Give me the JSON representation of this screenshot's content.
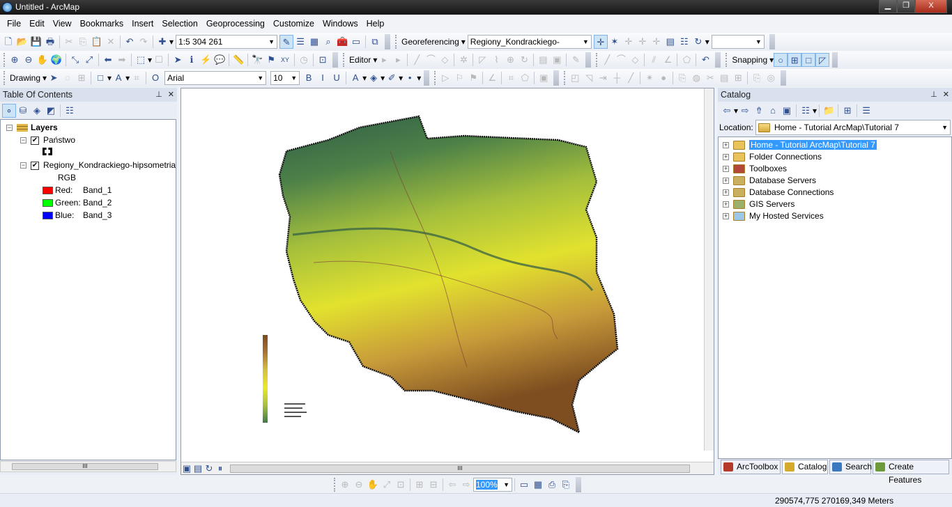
{
  "window": {
    "title": "Untitled - ArcMap",
    "minimize": "▁",
    "restore": "❐",
    "close": "X"
  },
  "menu": [
    "File",
    "Edit",
    "View",
    "Bookmarks",
    "Insert",
    "Selection",
    "Geoprocessing",
    "Customize",
    "Windows",
    "Help"
  ],
  "toolbar1": [
    {
      "i": "new-document",
      "g": "🗋"
    },
    {
      "i": "open",
      "g": "📂"
    },
    {
      "i": "save",
      "g": "💾"
    },
    {
      "i": "print",
      "g": "🖶"
    },
    {
      "s": 1
    },
    {
      "i": "cut",
      "g": "✂",
      "d": 1
    },
    {
      "i": "copy",
      "g": "⎘",
      "d": 1
    },
    {
      "i": "paste",
      "g": "📋"
    },
    {
      "i": "delete",
      "g": "✕",
      "d": 1
    },
    {
      "s": 1
    },
    {
      "i": "undo",
      "g": "↶"
    },
    {
      "i": "redo",
      "g": "↷",
      "d": 1
    },
    {
      "s": 1
    },
    {
      "i": "add-data",
      "g": "✚",
      "dd": 1
    },
    {
      "combo": "1:5 304 261",
      "w": 146,
      "n": "map-scale-combo"
    },
    {
      "i": "editor-toolbar",
      "g": "✎",
      "a": 1
    },
    {
      "i": "table-of-contents-window",
      "g": "☰"
    },
    {
      "i": "catalog-window",
      "g": "▦"
    },
    {
      "i": "search-window",
      "g": "⌕"
    },
    {
      "i": "arctoolbox-window",
      "g": "🧰"
    },
    {
      "i": "python-window",
      "g": "▭"
    },
    {
      "s": 1
    },
    {
      "i": "modelbuilder",
      "g": "⧉"
    },
    {
      "grip": 1
    },
    {
      "dots": 1
    },
    {
      "label": "Georeferencing",
      "dd": 1,
      "n": "georeferencing-menu"
    },
    {
      "combo": "Regiony_Kondrackiego-hipsomet",
      "w": 178,
      "n": "georeference-layer-combo"
    },
    {
      "i": "add-control-points",
      "g": "✛",
      "a": 1
    },
    {
      "i": "auto-adjust",
      "g": "✶"
    },
    {
      "i": "rotate",
      "g": "✛",
      "d": 1
    },
    {
      "i": "shift",
      "g": "✛",
      "d": 1
    },
    {
      "i": "scale",
      "g": "✛",
      "d": 1
    },
    {
      "i": "view-link-table",
      "g": "▤"
    },
    {
      "i": "link-table",
      "g": "☷"
    },
    {
      "i": "flip-rotate",
      "g": "↻",
      "dd": 1
    },
    {
      "combo": "",
      "w": 76,
      "n": "rotation-input"
    },
    {
      "grip": 1
    }
  ],
  "toolbar2": [
    {
      "dots": 1
    },
    {
      "i": "zoom-in",
      "g": "⊕"
    },
    {
      "i": "zoom-out",
      "g": "⊖"
    },
    {
      "i": "pan",
      "g": "✋"
    },
    {
      "i": "full-extent",
      "g": "🌍"
    },
    {
      "s": 1
    },
    {
      "i": "fixed-zoom-in",
      "g": "⤡"
    },
    {
      "i": "fixed-zoom-out",
      "g": "⤢"
    },
    {
      "s": 1
    },
    {
      "i": "back-extent",
      "g": "⬅"
    },
    {
      "i": "forward-extent",
      "g": "➡",
      "d": 1
    },
    {
      "s": 1
    },
    {
      "i": "select-features",
      "g": "⬚",
      "dd": 1
    },
    {
      "i": "clear-selection",
      "g": "☐",
      "d": 1
    },
    {
      "s": 1
    },
    {
      "i": "select-elements",
      "g": "➤"
    },
    {
      "i": "identify",
      "g": "ℹ"
    },
    {
      "i": "hyperlink",
      "g": "⚡",
      "d": 1
    },
    {
      "i": "html-popup",
      "g": "💬"
    },
    {
      "s": 1
    },
    {
      "i": "measure",
      "g": "📏"
    },
    {
      "s": 1
    },
    {
      "i": "find",
      "g": "🔭"
    },
    {
      "i": "find-route",
      "g": "⚑"
    },
    {
      "i": "go-to-xy",
      "g": "XY"
    },
    {
      "s": 1
    },
    {
      "i": "time-slider",
      "g": "◷",
      "d": 1
    },
    {
      "s": 1
    },
    {
      "i": "create-viewer-window",
      "g": "⊡"
    },
    {
      "grip": 1
    },
    {
      "dots": 1
    },
    {
      "label": "Editor",
      "dd": 1,
      "n": "editor-menu"
    },
    {
      "i": "edit-tool",
      "g": "▸",
      "d": 1
    },
    {
      "i": "edit-annotation",
      "g": "▸",
      "d": 1
    },
    {
      "s": 1
    },
    {
      "i": "straight-segment",
      "g": "╱",
      "d": 1
    },
    {
      "i": "endpoint-arc",
      "g": "⌒",
      "d": 1
    },
    {
      "i": "construction",
      "g": "◇",
      "d": 1
    },
    {
      "s": 1
    },
    {
      "i": "cut-polygons",
      "g": "✲",
      "d": 1
    },
    {
      "s": 1
    },
    {
      "i": "edit-vertices",
      "g": "◸",
      "d": 1
    },
    {
      "i": "reshape",
      "g": "⌇",
      "d": 1
    },
    {
      "i": "split",
      "g": "⊕",
      "d": 1
    },
    {
      "i": "rotate-tool",
      "g": "↻",
      "d": 1
    },
    {
      "s": 1
    },
    {
      "i": "attributes",
      "g": "▤",
      "d": 1
    },
    {
      "i": "sketch-properties",
      "g": "▣",
      "d": 1
    },
    {
      "s": 1
    },
    {
      "i": "create-features",
      "g": "✎",
      "d": 1
    },
    {
      "grip": 1
    },
    {
      "dots": 1
    },
    {
      "i": "line",
      "g": "╱",
      "d": 1
    },
    {
      "i": "curve",
      "g": "⌒",
      "d": 1
    },
    {
      "i": "trace",
      "g": "◇",
      "d": 1
    },
    {
      "s": 1
    },
    {
      "i": "parallel",
      "g": "⫽",
      "d": 1
    },
    {
      "i": "angle",
      "g": "∠",
      "d": 1
    },
    {
      "s": 1
    },
    {
      "i": "polygon",
      "g": "⬠",
      "d": 1
    },
    {
      "s": 1
    },
    {
      "i": "undo-edit",
      "g": "↶"
    },
    {
      "grip": 1
    },
    {
      "dots": 1
    },
    {
      "label": "Snapping",
      "dd": 1,
      "n": "snapping-menu"
    },
    {
      "i": "point-snapping",
      "g": "○",
      "a": 1
    },
    {
      "i": "end-snapping",
      "g": "⊞",
      "a": 1
    },
    {
      "i": "vertex-snapping",
      "g": "□",
      "a": 1
    },
    {
      "i": "edge-snapping",
      "g": "◸",
      "a": 1
    },
    {
      "grip": 1
    }
  ],
  "toolbar3": [
    {
      "dots": 1
    },
    {
      "label": "Drawing",
      "dd": 1,
      "n": "drawing-menu"
    },
    {
      "i": "select-elements",
      "g": "➤"
    },
    {
      "i": "rotate-element",
      "g": "◌",
      "d": 1
    },
    {
      "i": "zoom-to-selected",
      "g": "⊞",
      "d": 1
    },
    {
      "s": 1
    },
    {
      "i": "rectangle",
      "g": "□",
      "dd": 1
    },
    {
      "i": "new-text",
      "g": "A",
      "dd": 1
    },
    {
      "i": "edit-vertices",
      "g": "⌗",
      "d": 1
    },
    {
      "s": 1
    },
    {
      "i": "font-type",
      "g": "O"
    },
    {
      "combo": "Arial",
      "w": 146,
      "n": "font-combo"
    },
    {
      "combo": "10",
      "w": 42,
      "n": "font-size-combo"
    },
    {
      "i": "bold",
      "g": "B"
    },
    {
      "i": "italic",
      "g": "I"
    },
    {
      "i": "underline",
      "g": "U"
    },
    {
      "s": 1
    },
    {
      "i": "font-color",
      "g": "A",
      "dd": 1
    },
    {
      "i": "fill-color",
      "g": "◈",
      "dd": 1
    },
    {
      "i": "line-color",
      "g": "✐",
      "dd": 1
    },
    {
      "i": "marker-color",
      "g": "•",
      "dd": 1
    },
    {
      "grip": 1
    },
    {
      "dots": 1
    },
    {
      "i": "edit-annotation-tool",
      "g": "▷",
      "d": 1
    },
    {
      "i": "add-feature",
      "g": "⚐",
      "d": 1
    },
    {
      "i": "follow-feature",
      "g": "⚑",
      "d": 1
    },
    {
      "s": 1
    },
    {
      "i": "leader",
      "g": "∠",
      "d": 1
    },
    {
      "s": 1
    },
    {
      "i": "convert",
      "g": "⌗",
      "d": 1
    },
    {
      "i": "polygon-tool",
      "g": "⬠",
      "d": 1
    },
    {
      "s": 1
    },
    {
      "i": "properties",
      "g": "▣",
      "d": 1
    },
    {
      "grip": 1
    },
    {
      "dots": 1
    },
    {
      "i": "topology-edit",
      "g": "◰",
      "d": 1
    },
    {
      "i": "topology-modify",
      "g": "◹",
      "d": 1
    },
    {
      "i": "split-lines",
      "g": "⇥",
      "d": 1
    },
    {
      "i": "edge",
      "g": "┼",
      "d": 1
    },
    {
      "i": "reshape-edge",
      "g": "╱",
      "d": 1
    },
    {
      "s": 1
    },
    {
      "i": "validate",
      "g": "✴",
      "d": 1
    },
    {
      "i": "sphere",
      "g": "●",
      "d": 1
    },
    {
      "s": 1
    },
    {
      "i": "map-topology",
      "g": "⎘",
      "d": 1
    },
    {
      "i": "fix",
      "g": "◍",
      "d": 1
    },
    {
      "i": "tools",
      "g": "✂",
      "d": 1
    },
    {
      "i": "table",
      "g": "▤",
      "d": 1
    },
    {
      "i": "shared",
      "g": "⊞",
      "d": 1
    },
    {
      "s": 1
    },
    {
      "i": "error-inspector",
      "g": "⎘",
      "d": 1
    },
    {
      "i": "rules",
      "g": "◎",
      "d": 1
    },
    {
      "grip": 1
    }
  ],
  "toc": {
    "title": "Table Of Contents",
    "pin": "⊥",
    "close": "✕",
    "tools": [
      {
        "i": "list-by-drawing-order",
        "g": "⚬",
        "a": 1
      },
      {
        "i": "list-by-source",
        "g": "⛁"
      },
      {
        "i": "list-by-visibility",
        "g": "◈"
      },
      {
        "i": "list-by-selection",
        "g": "◩"
      },
      {
        "s": 1
      },
      {
        "i": "options",
        "g": "☷"
      }
    ],
    "root": "Layers",
    "layers": [
      {
        "name": "Państwo",
        "checked": true
      },
      {
        "name": "Regiony_Kondrackiego-hipsometria",
        "checked": true,
        "renderer": "RGB",
        "bands": [
          {
            "label": "Red:",
            "band": "Band_1",
            "color": "#ff0000"
          },
          {
            "label": "Green:",
            "band": "Band_2",
            "color": "#00ff00"
          },
          {
            "label": "Blue:",
            "band": "Band_3",
            "color": "#0000ff"
          }
        ]
      }
    ]
  },
  "catalog": {
    "title": "Catalog",
    "pin": "⊥",
    "close": "✕",
    "tools": [
      {
        "i": "back",
        "g": "⇦",
        "dd": 1
      },
      {
        "i": "forward",
        "g": "⇨"
      },
      {
        "i": "up-one-level",
        "g": "⇮"
      },
      {
        "i": "home-folder",
        "g": "⌂"
      },
      {
        "i": "connect-folder",
        "g": "▣"
      },
      {
        "s": 1
      },
      {
        "i": "views",
        "g": "☷",
        "dd": 1
      },
      {
        "s": 1
      },
      {
        "i": "new-folder",
        "g": "📁"
      },
      {
        "s": 1
      },
      {
        "i": "toggle-contents",
        "g": "⊞"
      },
      {
        "s": 1
      },
      {
        "i": "options",
        "g": "☰"
      }
    ],
    "location_label": "Location:",
    "location": "Home - Tutorial ArcMap\\Tutorial 7",
    "items": [
      "Home - Tutorial ArcMap\\Tutorial 7",
      "Folder Connections",
      "Toolboxes",
      "Database Servers",
      "Database Connections",
      "GIS Servers",
      "My Hosted Services"
    ]
  },
  "dock_tabs": [
    {
      "label": "ArcToolbox",
      "color": "#b53a2a"
    },
    {
      "label": "Catalog",
      "color": "#d4a92c"
    },
    {
      "label": "Search",
      "color": "#3b78c0"
    },
    {
      "label": "Create Features",
      "color": "#6f9a3c"
    }
  ],
  "map": {
    "legend_colors": [
      "#7a4a22",
      "#a87435",
      "#d8c040",
      "#e9e830",
      "#a8c040",
      "#3f7a4a"
    ],
    "map_colors": [
      "#2f5d48",
      "#4c8048",
      "#a4bf3c",
      "#e2e22e",
      "#c89a3a",
      "#7e4e20"
    ]
  },
  "layout_toolbar": {
    "zoom": "100%",
    "tools": [
      {
        "i": "layout-zoom-in",
        "g": "⊕"
      },
      {
        "i": "layout-zoom-out",
        "g": "⊖"
      },
      {
        "i": "layout-pan",
        "g": "✋"
      },
      {
        "i": "zoom-whole-page",
        "g": "⤢"
      },
      {
        "i": "zoom-100",
        "g": "⊡"
      },
      {
        "s": 1
      },
      {
        "i": "fixed-zoom-in",
        "g": "⊞"
      },
      {
        "i": "fixed-zoom-out",
        "g": "⊟"
      },
      {
        "s": 1
      },
      {
        "i": "previous-extent",
        "g": "⇦"
      },
      {
        "i": "next-extent",
        "g": "⇨"
      }
    ],
    "tools2": [
      {
        "i": "toggle-draft-mode",
        "g": "▭"
      },
      {
        "i": "focus-data-frame",
        "g": "▦"
      },
      {
        "i": "change-layout",
        "g": "⎙"
      },
      {
        "i": "data-driven-pages",
        "g": "⎘"
      }
    ]
  },
  "status": {
    "coordinates": "290574,775  270169,349 Meters"
  },
  "mapnav": {
    "layout_view": "▣",
    "data_view": "▤",
    "refresh": "↻",
    "pause": "⏸"
  }
}
